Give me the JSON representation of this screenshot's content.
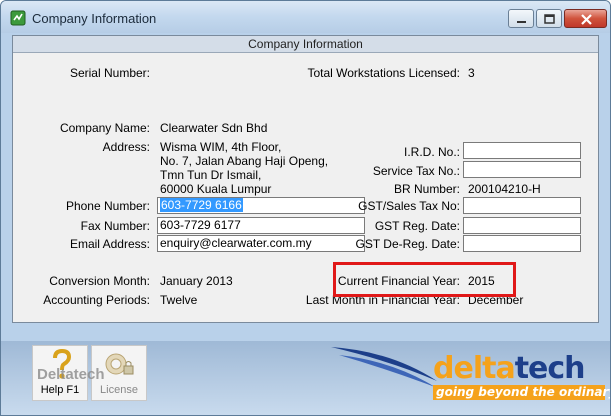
{
  "window": {
    "title": "Company Information",
    "controls": [
      "minimize",
      "maximize",
      "close"
    ]
  },
  "panel": {
    "header": "Company Information",
    "labels": {
      "serial_number": "Serial Number:",
      "total_workstations": "Total Workstations Licensed:",
      "company_name": "Company Name:",
      "address": "Address:",
      "ird_no": "I.R.D. No.:",
      "service_tax_no": "Service Tax No.:",
      "br_number": "BR Number:",
      "phone_number": "Phone Number:",
      "gst_sales_tax_no": "GST/Sales Tax No:",
      "fax_number": "Fax Number:",
      "gst_reg_date": "GST Reg. Date:",
      "email_address": "Email Address:",
      "gst_dereg_date": "GST De-Reg. Date:",
      "conversion_month": "Conversion Month:",
      "current_financial_year": "Current Financial Year:",
      "accounting_periods": "Accounting Periods:",
      "last_month_financial_year": "Last Month in Financial Year:"
    },
    "values": {
      "serial_number": "",
      "total_workstations": "3",
      "company_name": "Clearwater Sdn Bhd",
      "address_lines": [
        "Wisma WIM, 4th Floor,",
        "No. 7, Jalan Abang Haji Openg,",
        "Tmn Tun Dr Ismail,",
        "60000 Kuala Lumpur"
      ],
      "ird_no": "",
      "service_tax_no": "",
      "br_number": "200104210-H",
      "phone_number": "603-7729 6166",
      "gst_sales_tax_no": "",
      "fax_number": "603-7729 6177",
      "gst_reg_date": "",
      "email_address": "enquiry@clearwater.com.my",
      "gst_dereg_date": "",
      "conversion_month": "January 2013",
      "current_financial_year": "2015",
      "accounting_periods": "Twelve",
      "last_month_financial_year": "December"
    }
  },
  "toolbar": {
    "help_label": "Help F1",
    "license_label": "License"
  },
  "branding": {
    "watermark": "Deltatech",
    "logo_part1": "delta",
    "logo_part2": "tech",
    "tagline": "going beyond the ordinary!",
    "accent_color": "#f5a21b",
    "brand_color": "#1d3f8a",
    "highlight_color": "#e01818"
  }
}
